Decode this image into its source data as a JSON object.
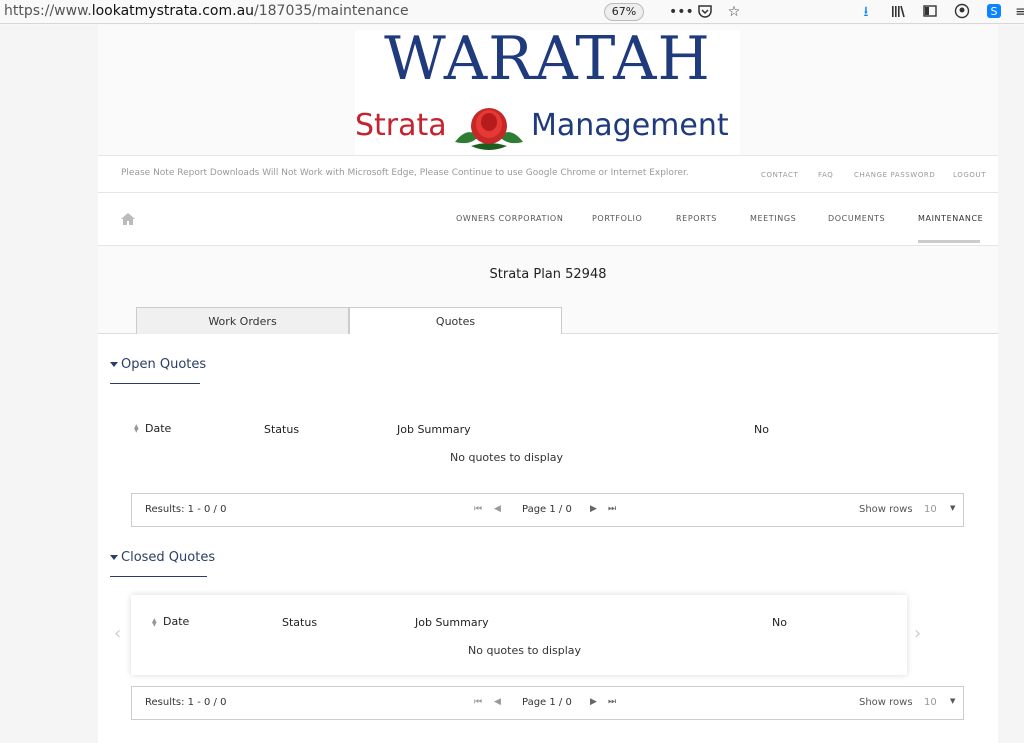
{
  "browser": {
    "url_prefix": "https://www.",
    "url_domain": "lookatmystrata.com.au",
    "url_path": "/187035/maintenance",
    "zoom": "67%",
    "icons": [
      "more-icon",
      "pocket-icon",
      "bookmark-star-icon",
      "download-icon",
      "library-icon",
      "sidebar-icon",
      "account-icon",
      "skype-icon",
      "menu-icon"
    ]
  },
  "logo": {
    "title": "WARATAH",
    "strata": "Strata",
    "management": "Management"
  },
  "notice": "Please Note Report Downloads Will Not Work with Microsoft Edge, Please Continue to use Google Chrome or Internet Explorer.",
  "util_links": {
    "contact": "CONTACT",
    "faq": "FAQ",
    "change_password": "CHANGE PASSWORD",
    "logout": "LOGOUT"
  },
  "nav": {
    "owners": "OWNERS CORPORATION",
    "portfolio": "PORTFOLIO",
    "reports": "REPORTS",
    "meetings": "MEETINGS",
    "documents": "DOCUMENTS",
    "maintenance": "MAINTENANCE"
  },
  "plan_title": "Strata Plan 52948",
  "tabs": {
    "work_orders": "Work Orders",
    "quotes": "Quotes"
  },
  "open_quotes": {
    "heading": "Open Quotes",
    "columns": {
      "date": "Date",
      "status": "Status",
      "summary": "Job Summary",
      "no": "No"
    },
    "empty": "No quotes to display",
    "pager": {
      "results": "Results: 1 - 0 / 0",
      "page": "Page 1 / 0",
      "show_rows": "Show rows",
      "rows": "10"
    }
  },
  "closed_quotes": {
    "heading": "Closed Quotes",
    "columns": {
      "date": "Date",
      "status": "Status",
      "summary": "Job Summary",
      "no": "No"
    },
    "empty": "No quotes to display",
    "pager": {
      "results": "Results: 1 - 0 / 0",
      "page": "Page 1 / 0",
      "show_rows": "Show rows",
      "rows": "10"
    }
  },
  "colors": {
    "brand_blue": "#1f3b7d",
    "brand_red": "#c5232f",
    "section_blue": "#2b3e63"
  }
}
